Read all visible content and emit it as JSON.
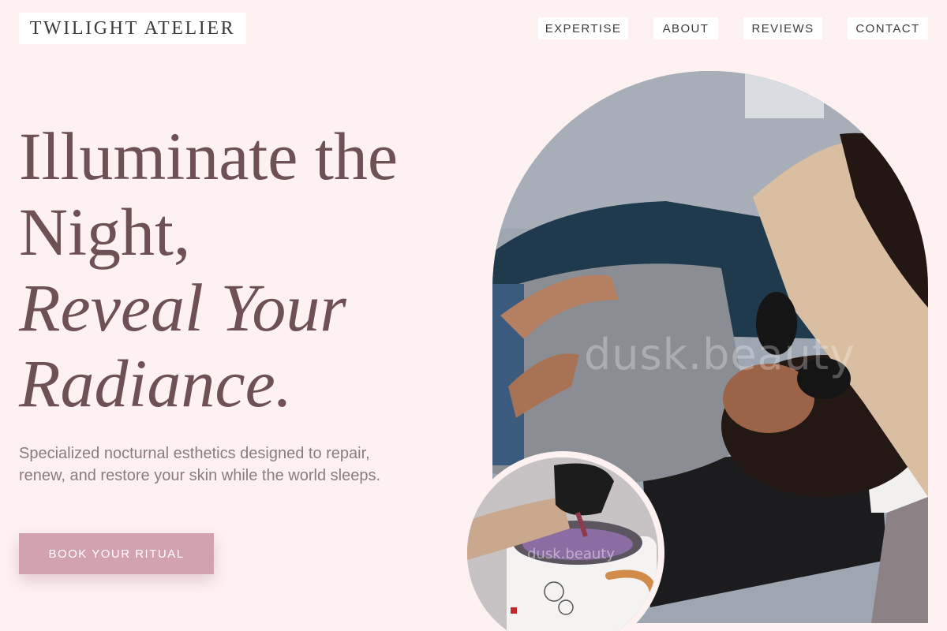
{
  "brand": {
    "name": "TWILIGHT ATELIER"
  },
  "nav": {
    "items": [
      {
        "label": "EXPERTISE"
      },
      {
        "label": "ABOUT"
      },
      {
        "label": "REVIEWS"
      },
      {
        "label": "CONTACT"
      }
    ]
  },
  "hero": {
    "headline_line1": "Illuminate the",
    "headline_line2": "Night,",
    "headline_line3": "Reveal Your",
    "headline_line4": "Radiance.",
    "subtext": "Specialized nocturnal esthetics designed to repair, renew, and restore your skin while the world sleeps.",
    "cta_label": "BOOK YOUR RITUAL"
  },
  "images": {
    "main_watermark": "dusk.beauty",
    "inset_watermark": "dusk.beauty"
  },
  "colors": {
    "background": "#fdf1f1",
    "headline": "#6f5155",
    "body_text": "#8c7b80",
    "cta_background": "#d2a2b0",
    "nav_background": "#ffffff"
  }
}
